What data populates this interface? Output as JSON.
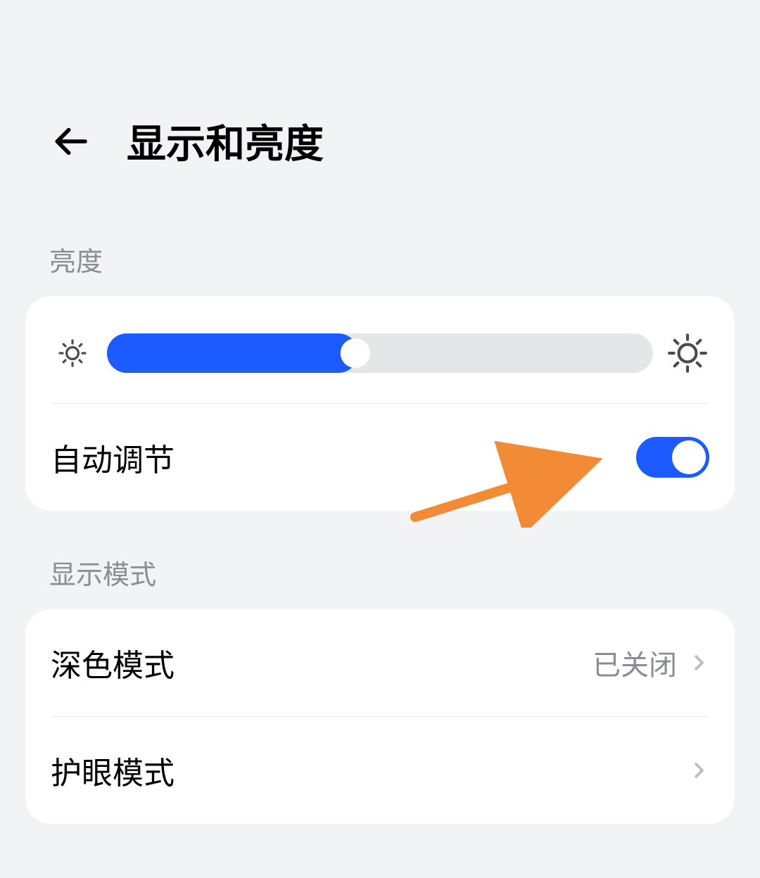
{
  "header": {
    "title": "显示和亮度"
  },
  "brightness": {
    "section_label": "亮度",
    "slider_percent": 46,
    "auto_adjust_label": "自动调节",
    "auto_adjust_on": true
  },
  "display_mode": {
    "section_label": "显示模式",
    "items": [
      {
        "label": "深色模式",
        "value": "已关闭"
      },
      {
        "label": "护眼模式",
        "value": ""
      }
    ]
  },
  "colors": {
    "accent": "#1b5bff",
    "annotation": "#f38b36",
    "bg": "#f2f3f5"
  }
}
